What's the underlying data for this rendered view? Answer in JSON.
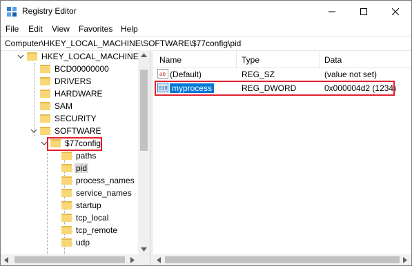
{
  "window": {
    "title": "Registry Editor",
    "controls": [
      "minimize",
      "maximize",
      "close"
    ]
  },
  "menu": [
    "File",
    "Edit",
    "View",
    "Favorites",
    "Help"
  ],
  "address": "Computer\\HKEY_LOCAL_MACHINE\\SOFTWARE\\$77config\\pid",
  "tree": {
    "root": "HKEY_LOCAL_MACHINE",
    "hklm_children": [
      "BCD00000000",
      "DRIVERS",
      "HARDWARE",
      "SAM",
      "SECURITY",
      "SOFTWARE"
    ],
    "software_child": "$77config",
    "config_children": [
      "paths",
      "pid",
      "process_names",
      "service_names",
      "startup",
      "tcp_local",
      "tcp_remote",
      "udp"
    ],
    "selected": "pid"
  },
  "list": {
    "columns": [
      "Name",
      "Type",
      "Data"
    ],
    "rows": [
      {
        "name": "(Default)",
        "type": "REG_SZ",
        "data": "(value not set)",
        "icon": "string-value-icon"
      },
      {
        "name": "myprocess",
        "type": "REG_DWORD",
        "data": "0x000004d2 (1234)",
        "icon": "binary-value-icon",
        "selected": true
      }
    ]
  },
  "highlight_color": "#e0202c",
  "selection_color": "#0078d7"
}
